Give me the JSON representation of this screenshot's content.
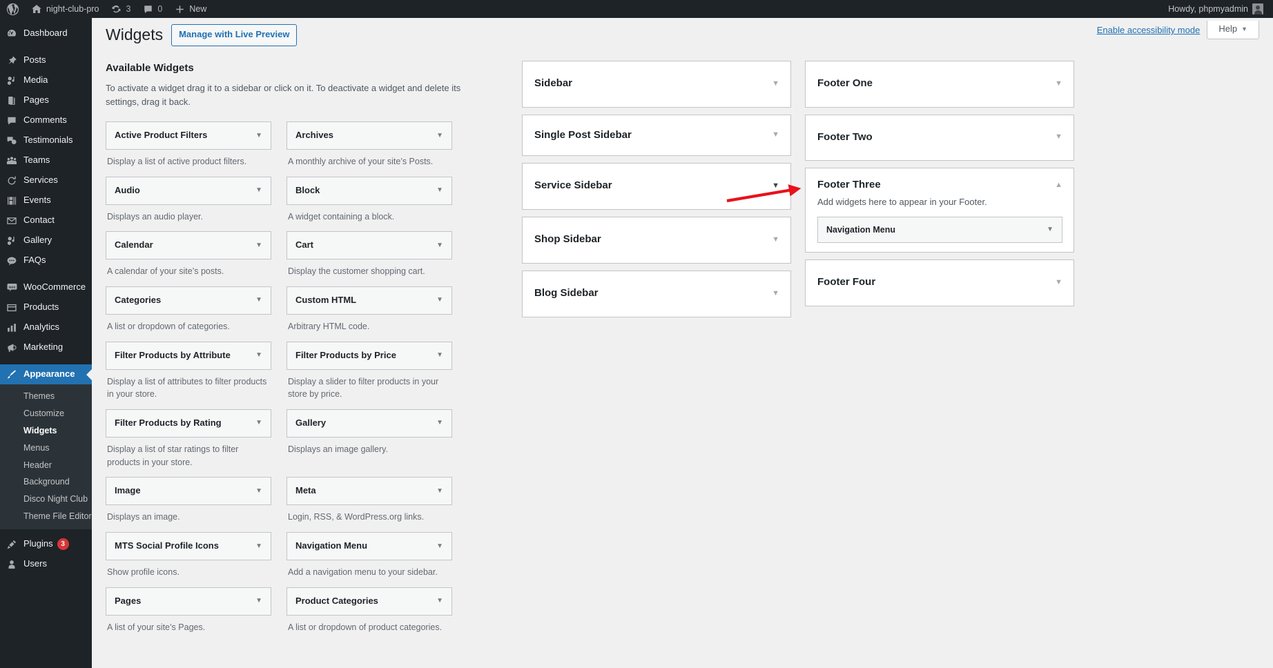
{
  "adminbar": {
    "logo_icon": "wordpress-logo-icon",
    "site_name": "night-club-pro",
    "home_icon": "home-icon",
    "updates_icon": "updates-icon",
    "updates_count": "3",
    "comments_icon": "comment-bubble-icon",
    "comments_count": "0",
    "new_icon": "plus-icon",
    "new_label": "New",
    "howdy": "Howdy, phpmyadmin",
    "avatar_icon": "avatar-icon"
  },
  "sidebar": {
    "items": [
      {
        "label": "Dashboard",
        "icon": "dashboard-icon",
        "current": false
      },
      {
        "label": "Posts",
        "icon": "pin-icon",
        "current": false
      },
      {
        "label": "Media",
        "icon": "media-icon",
        "current": false
      },
      {
        "label": "Pages",
        "icon": "pages-icon",
        "current": false
      },
      {
        "label": "Comments",
        "icon": "comment-bubble-icon",
        "current": false
      },
      {
        "label": "Testimonials",
        "icon": "testimonials-icon",
        "current": false
      },
      {
        "label": "Teams",
        "icon": "groups-icon",
        "current": false
      },
      {
        "label": "Services",
        "icon": "update-icon",
        "current": false
      },
      {
        "label": "Events",
        "icon": "events-icon",
        "current": false
      },
      {
        "label": "Contact",
        "icon": "email-icon",
        "current": false
      },
      {
        "label": "Gallery",
        "icon": "media-icon",
        "current": false
      },
      {
        "label": "FAQs",
        "icon": "faq-icon",
        "current": false
      },
      {
        "label": "WooCommerce",
        "icon": "woocommerce-icon",
        "current": false
      },
      {
        "label": "Products",
        "icon": "products-icon",
        "current": false
      },
      {
        "label": "Analytics",
        "icon": "chart-bar-icon",
        "current": false
      },
      {
        "label": "Marketing",
        "icon": "megaphone-icon",
        "current": false
      },
      {
        "label": "Appearance",
        "icon": "paintbrush-icon",
        "current": true
      }
    ],
    "appearance_submenu": [
      {
        "label": "Themes",
        "current": false
      },
      {
        "label": "Customize",
        "current": false
      },
      {
        "label": "Widgets",
        "current": true
      },
      {
        "label": "Menus",
        "current": false
      },
      {
        "label": "Header",
        "current": false
      },
      {
        "label": "Background",
        "current": false
      },
      {
        "label": "Disco Night Club",
        "current": false
      },
      {
        "label": "Theme File Editor",
        "current": false
      }
    ],
    "bottom_items": [
      {
        "label": "Plugins",
        "icon": "plugin-icon",
        "badge": "3"
      },
      {
        "label": "Users",
        "icon": "user-icon",
        "badge": ""
      }
    ]
  },
  "screen_meta": {
    "accessibility_link": "Enable accessibility mode",
    "help_label": "Help",
    "help_caret_icon": "chevron-down-icon"
  },
  "header": {
    "title": "Widgets",
    "live_preview_button": "Manage with Live Preview"
  },
  "available": {
    "heading": "Available Widgets",
    "description": "To activate a widget drag it to a sidebar or click on it. To deactivate a widget and delete its settings, drag it back.",
    "arrow_icon": "chevron-down-icon",
    "widgets": [
      {
        "title": "Active Product Filters",
        "desc": "Display a list of active product filters."
      },
      {
        "title": "Archives",
        "desc": "A monthly archive of your site’s Posts."
      },
      {
        "title": "Audio",
        "desc": "Displays an audio player."
      },
      {
        "title": "Block",
        "desc": "A widget containing a block."
      },
      {
        "title": "Calendar",
        "desc": "A calendar of your site’s posts."
      },
      {
        "title": "Cart",
        "desc": "Display the customer shopping cart."
      },
      {
        "title": "Categories",
        "desc": "A list or dropdown of categories."
      },
      {
        "title": "Custom HTML",
        "desc": "Arbitrary HTML code."
      },
      {
        "title": "Filter Products by Attribute",
        "desc": "Display a list of attributes to filter products in your store."
      },
      {
        "title": "Filter Products by Price",
        "desc": "Display a slider to filter products in your store by price."
      },
      {
        "title": "Filter Products by Rating",
        "desc": "Display a list of star ratings to filter products in your store."
      },
      {
        "title": "Gallery",
        "desc": "Displays an image gallery."
      },
      {
        "title": "Image",
        "desc": "Displays an image."
      },
      {
        "title": "Meta",
        "desc": "Login, RSS, & WordPress.org links."
      },
      {
        "title": "MTS Social Profile Icons",
        "desc": "Show profile icons."
      },
      {
        "title": "Navigation Menu",
        "desc": "Add a navigation menu to your sidebar."
      },
      {
        "title": "Pages",
        "desc": "A list of your site’s Pages."
      },
      {
        "title": "Product Categories",
        "desc": "A list or dropdown of product categories."
      }
    ]
  },
  "sidebars_col1": [
    {
      "name": "Sidebar",
      "expanded": false,
      "arrow_icon": "chevron-down-icon",
      "arrow_tone": "light",
      "tall": true
    },
    {
      "name": "Single Post Sidebar",
      "expanded": false,
      "arrow_icon": "chevron-down-icon",
      "arrow_tone": "light",
      "tall": false
    },
    {
      "name": "Service Sidebar",
      "expanded": false,
      "arrow_icon": "chevron-down-icon",
      "arrow_tone": "dark",
      "tall": true
    },
    {
      "name": "Shop Sidebar",
      "expanded": false,
      "arrow_icon": "chevron-down-icon",
      "arrow_tone": "light",
      "tall": true
    },
    {
      "name": "Blog Sidebar",
      "expanded": false,
      "arrow_icon": "chevron-down-icon",
      "arrow_tone": "light",
      "tall": true
    }
  ],
  "sidebars_col2": [
    {
      "name": "Footer One",
      "expanded": false,
      "arrow_icon": "chevron-down-icon",
      "arrow_tone": "light",
      "tall": true
    },
    {
      "name": "Footer Two",
      "expanded": false,
      "arrow_icon": "chevron-down-icon",
      "arrow_tone": "light",
      "tall": true
    },
    {
      "name": "Footer Three",
      "expanded": true,
      "arrow_icon": "chevron-up-icon",
      "arrow_tone": "light",
      "tall": false,
      "desc": "Add widgets here to appear in your Footer.",
      "widgets": [
        {
          "title": "Navigation Menu",
          "arrow_icon": "chevron-down-icon"
        }
      ]
    },
    {
      "name": "Footer Four",
      "expanded": false,
      "arrow_icon": "chevron-down-icon",
      "arrow_tone": "light",
      "tall": true
    }
  ],
  "annotation": {
    "arrow_color": "#e8121a",
    "points_to": "Navigation Menu widget in Footer Three"
  },
  "colors": {
    "admin_bg": "#1d2327",
    "accent_blue": "#2271b1",
    "page_bg": "#f0f0f1",
    "badge_red": "#d63638"
  }
}
